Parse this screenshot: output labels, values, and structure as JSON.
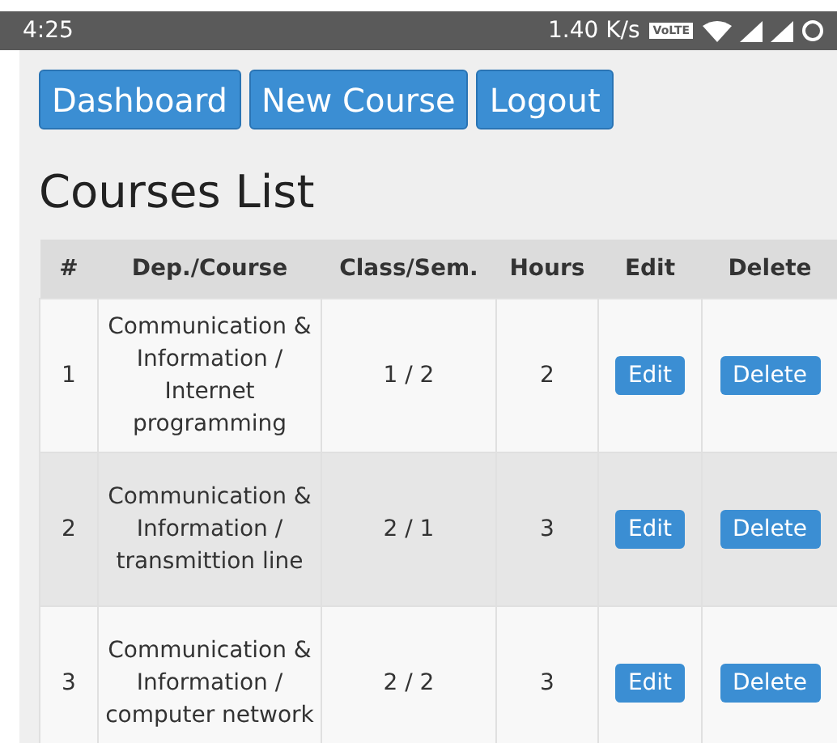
{
  "status_bar": {
    "time": "4:25",
    "speed": "1.40 K/s",
    "volte": "VoLTE"
  },
  "nav_buttons": [
    "Dashboard",
    "New Course",
    "Logout"
  ],
  "title": "Courses List",
  "table": {
    "columns": [
      "#",
      "Dep./Course",
      "Class/Sem.",
      "Hours",
      "Edit",
      "Delete"
    ],
    "rows": [
      {
        "number": "1",
        "course": "Communication & Information / Internet programming",
        "class_sem": "1 / 2",
        "hours": "2",
        "edit": "Edit",
        "delete": "Delete"
      },
      {
        "number": "2",
        "course": "Communication & Information / transmittion line",
        "class_sem": "2 / 1",
        "hours": "3",
        "edit": "Edit",
        "delete": "Delete"
      },
      {
        "number": "3",
        "course": "Communication & Information / computer network",
        "class_sem": "2 / 2",
        "hours": "3",
        "edit": "Edit",
        "delete": "Delete"
      }
    ]
  }
}
